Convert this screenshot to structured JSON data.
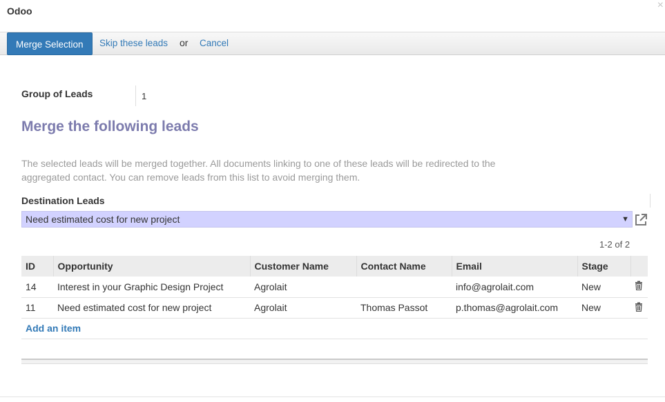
{
  "dialog": {
    "title": "Odoo",
    "close_glyph": "×"
  },
  "toolbar": {
    "merge_label": "Merge Selection",
    "skip_label": "Skip these leads",
    "or_label": "or",
    "cancel_label": "Cancel"
  },
  "form": {
    "group_label": "Group of Leads",
    "group_value": "1",
    "section_title": "Merge the following leads",
    "help_text": "The selected leads will be merged together. All documents linking to one of these leads will be redirected to the aggregated contact. You can remove leads from this list to avoid merging them.",
    "destination_label": "Destination Leads",
    "destination_value": "Need estimated cost for new project",
    "destination_arrow": "▼"
  },
  "list": {
    "pager": "1-2 of 2",
    "columns": [
      "ID",
      "Opportunity",
      "Customer Name",
      "Contact Name",
      "Email",
      "Stage"
    ],
    "rows": [
      {
        "id": "14",
        "opportunity": "Interest in your Graphic Design Project",
        "customer": "Agrolait",
        "contact": "",
        "email": "info@agrolait.com",
        "stage": "New"
      },
      {
        "id": "11",
        "opportunity": "Need estimated cost for new project",
        "customer": "Agrolait",
        "contact": "Thomas Passot",
        "email": "p.thomas@agrolait.com",
        "stage": "New"
      }
    ],
    "add_item_label": "Add an item"
  },
  "colors": {
    "accent": "#337ab7",
    "section_title": "#7c7bad",
    "select_bg": "#d2d2ff"
  },
  "icons": {
    "close": "close-icon",
    "external": "external-link-icon",
    "delete": "trash-icon"
  }
}
